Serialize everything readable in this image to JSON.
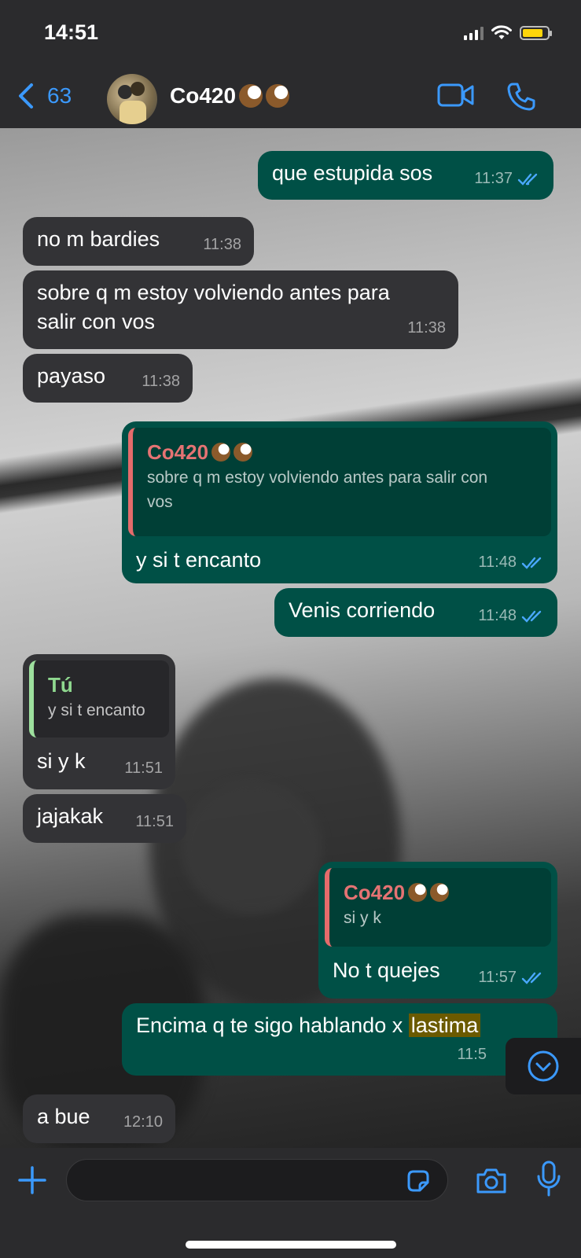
{
  "status_bar": {
    "time": "14:51"
  },
  "header": {
    "back_count": "63",
    "contact_name": "Co420"
  },
  "messages": [
    {
      "dir": "out",
      "text": "que estupida sos",
      "time": "11:37"
    },
    {
      "dir": "in",
      "text": "no m bardies",
      "time": "11:38"
    },
    {
      "dir": "in",
      "text_line1": "sobre q m estoy volviendo antes para",
      "text_line2": "salir con vos",
      "time": "11:38"
    },
    {
      "dir": "in",
      "text": "payaso",
      "time": "11:38"
    },
    {
      "dir": "out",
      "quote_author": "Co420",
      "quote_line1": "sobre q m estoy volviendo antes para salir con",
      "quote_line2": "vos",
      "text": "y si t encanto",
      "time": "11:48"
    },
    {
      "dir": "out",
      "text": "Venis corriendo",
      "time": "11:48"
    },
    {
      "dir": "in",
      "quote_author": "Tú",
      "quote_text": "y si t encanto",
      "text": "si y k",
      "time": "11:51"
    },
    {
      "dir": "in",
      "text": "jajakak",
      "time": "11:51"
    },
    {
      "dir": "out",
      "quote_author": "Co420",
      "quote_text": "si y k",
      "text": "No t quejes",
      "time": "11:57"
    },
    {
      "dir": "out",
      "text_plain": "Encima q te sigo hablando x ",
      "text_highlight": "lastima",
      "time": "11:5"
    },
    {
      "dir": "in",
      "text": "a bue",
      "time": "12:10"
    }
  ],
  "input": {
    "placeholder": ""
  },
  "colors": {
    "accent": "#3b99fc",
    "outgoing": "#005046",
    "incoming": "#333336",
    "battery": "#ffd60a"
  }
}
